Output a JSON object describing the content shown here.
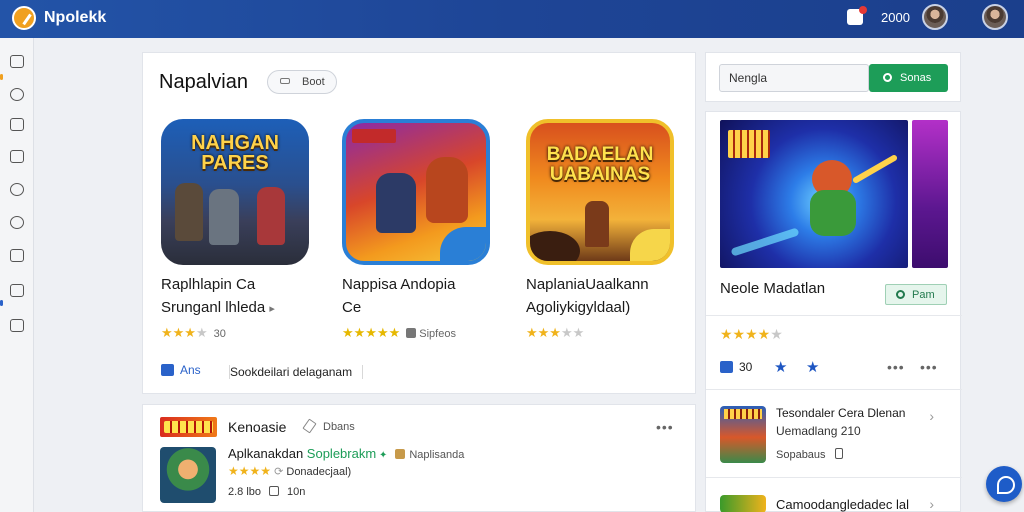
{
  "header": {
    "brand": "Npolekk",
    "points": "2000"
  },
  "main": {
    "title": "Napalvian",
    "filter_button": "Boot",
    "apps": [
      {
        "tile_text": "NAHGAN PARES",
        "name_line1": "Raplhlapin Ca",
        "name_line2": "Srunganl lhleda",
        "rating": 3,
        "meta": "30"
      },
      {
        "tile_text": "",
        "name_line1": "Nappisa Andopia",
        "name_line2": "Ce",
        "rating": 5,
        "meta": "Sipfeos"
      },
      {
        "tile_text": "BADAELAN UABAINAS",
        "name_line1": "NaplaniaUaalkann",
        "name_line2": "Agoliykigyldaal)",
        "rating": 3,
        "meta": ""
      }
    ],
    "footer_like": "Ans",
    "footer_link": "Sookdeilari delaganam"
  },
  "search": {
    "value": "Nengla",
    "button": "Sonas"
  },
  "featured": {
    "title": "Neole Madatlan",
    "button": "Pam",
    "rating": 4,
    "like_count": "30",
    "list": [
      {
        "title": "Tesondaler Cera Dlenan",
        "subtitle": "Uemadlang 210",
        "meta": "Sopabaus"
      },
      {
        "title": "Camoodangledadec lal",
        "subtitle": "",
        "meta": ""
      }
    ]
  },
  "bottom": {
    "title": "Kenoasie",
    "meta": "Dbans",
    "line1_name": "Aplkanakdan",
    "line1_green": "Soplebrakm",
    "line1_tag": "Naplisanda",
    "line2_text": "Donadecjaal)",
    "line3_left": "2.8 lbo",
    "line3_right": "10n"
  }
}
